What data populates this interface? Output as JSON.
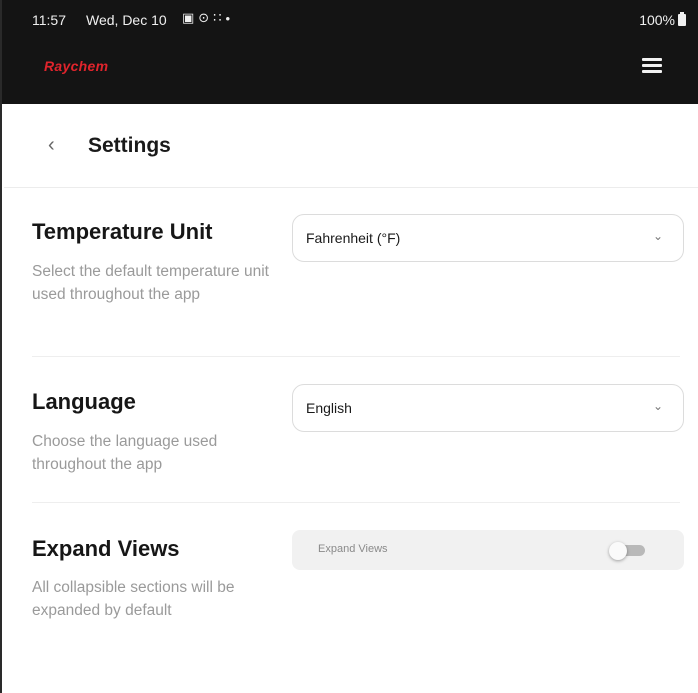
{
  "status_bar": {
    "time": "11:57",
    "date": "Wed, Dec 10",
    "icons": [
      "image-icon",
      "sync-icon",
      "grid-icon",
      "dot-icon"
    ],
    "battery": "100%"
  },
  "app_bar": {
    "brand": "Raychem",
    "brand_color": "#e0242c",
    "menu_icon": "hamburger-icon"
  },
  "header": {
    "back_icon": "chevron-left-icon",
    "title": "Settings"
  },
  "settings": {
    "temperature": {
      "title": "Temperature Unit",
      "description": "Select the default temperature unit used throughout the app",
      "value": "Fahrenheit (°F)"
    },
    "language": {
      "title": "Language",
      "description": "Choose the language used throughout the app",
      "value": "English"
    },
    "expand_views": {
      "title": "Expand Views",
      "description": "All collapsible sections will be expanded by default",
      "toggle_label": "Expand Views",
      "enabled": false
    }
  }
}
